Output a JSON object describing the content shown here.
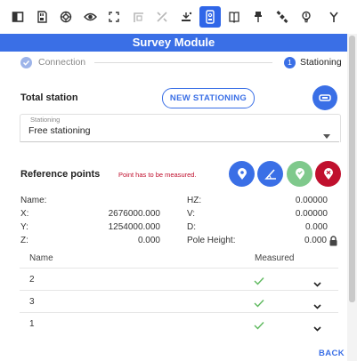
{
  "toolbar": {
    "icons": [
      "window-icon",
      "sd-card-icon",
      "target-icon",
      "eye-icon",
      "frame-icon",
      "corner-icon",
      "crossed-lines-icon",
      "sensor-icon",
      "phone-icon",
      "book-icon",
      "pin-icon",
      "satellite-icon",
      "lightbulb-icon",
      "y-icon"
    ],
    "active_index": 7
  },
  "header": {
    "title": "Survey Module"
  },
  "steps": {
    "step1": "Connection",
    "step2_number": "1",
    "step2": "Stationing"
  },
  "total_station": {
    "title": "Total station",
    "new_button": "NEW STATIONING"
  },
  "stationing_select": {
    "label": "Stationing",
    "value": "Free stationing"
  },
  "reference": {
    "title": "Reference points",
    "warning": "Point has to be measured."
  },
  "measure": {
    "name_label": "Name:",
    "name_value": "",
    "x_label": "X:",
    "x_value": "2676000.000",
    "y_label": "Y:",
    "y_value": "1254000.000",
    "z_label": "Z:",
    "z_value": "0.000",
    "hz_label": "HZ:",
    "hz_value": "0.00000",
    "v_label": "V:",
    "v_value": "0.00000",
    "d_label": "D:",
    "d_value": "0.000",
    "pole_label": "Pole Height:",
    "pole_value": "0.000"
  },
  "table": {
    "headers": [
      "Name",
      "Measured"
    ],
    "rows": [
      {
        "name": "2"
      },
      {
        "name": "3"
      },
      {
        "name": "1"
      }
    ]
  },
  "footer": {
    "back": "BACK"
  },
  "colors": {
    "accent": "#3a6fe6",
    "green": "#7fc98c",
    "red": "#c0102e",
    "check": "#5cb85c",
    "warning": "#c0102e"
  }
}
